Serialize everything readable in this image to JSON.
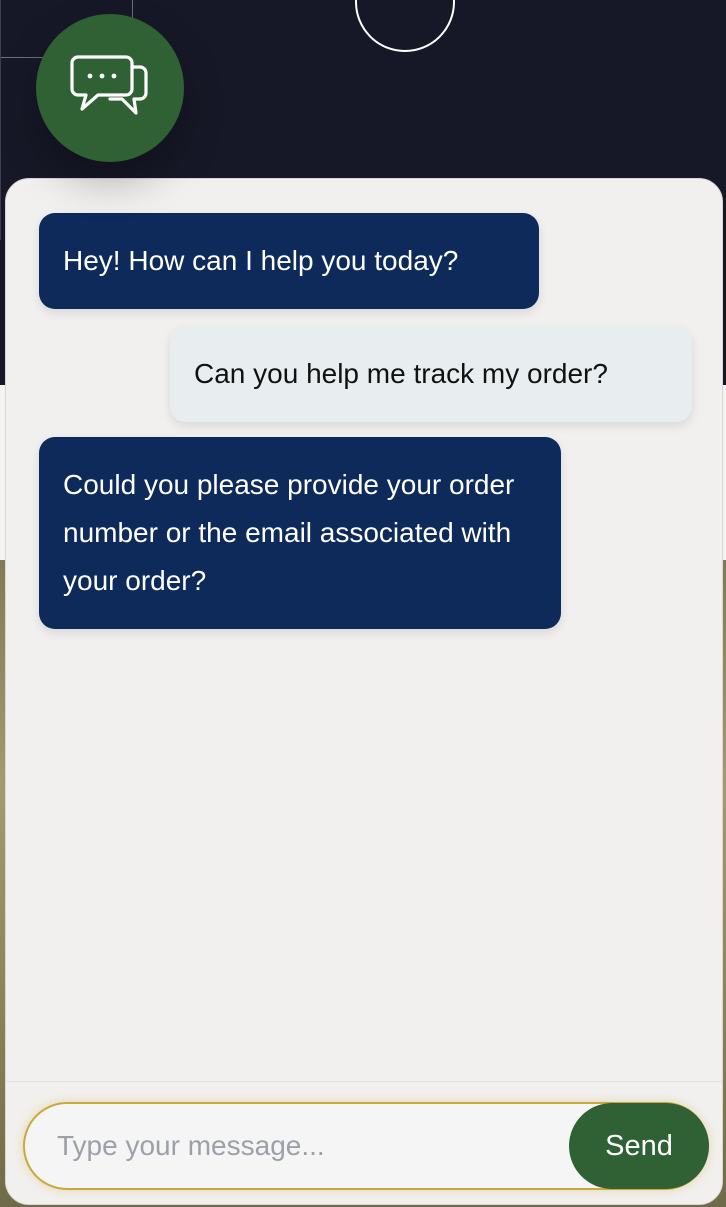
{
  "launcher": {
    "icon": "chat-bubbles-icon",
    "color": "#2f6134"
  },
  "chat": {
    "messages": [
      {
        "role": "bot",
        "text": "Hey! How can I help you today?"
      },
      {
        "role": "user",
        "text": "Can you help me track my order?"
      },
      {
        "role": "bot",
        "text": "Could you please provide your order number or the email associated with your order?"
      }
    ],
    "input": {
      "placeholder": "Type your message...",
      "value": ""
    },
    "send_label": "Send"
  },
  "colors": {
    "bot_bubble": "#0e2a5a",
    "user_bubble": "#e8eef0",
    "accent": "#2f6134",
    "input_border": "#c9a93a",
    "panel_bg": "#f2f0ee"
  }
}
